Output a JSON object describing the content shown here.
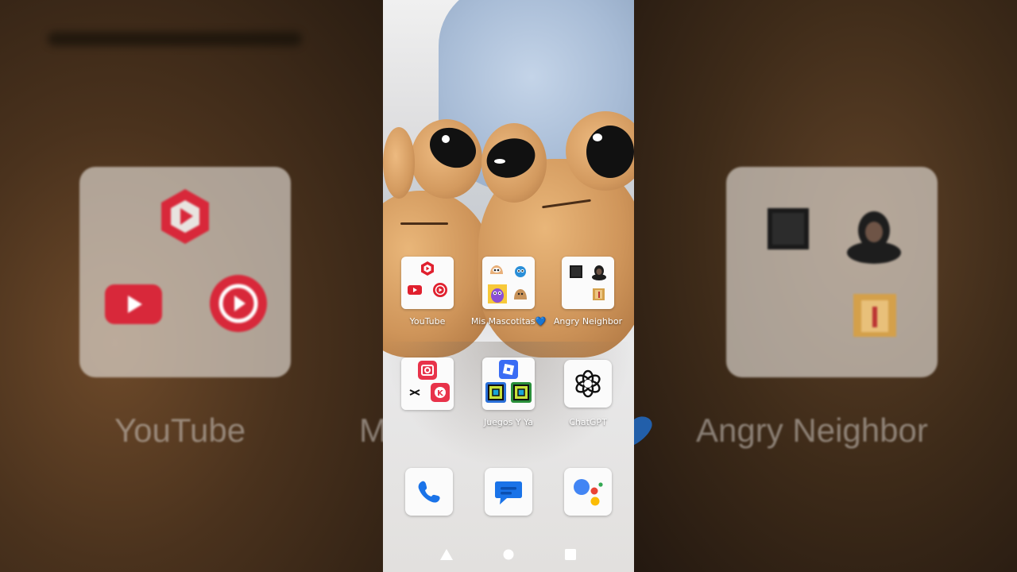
{
  "background": {
    "left_folder_label": "YouTube",
    "mid_partial_label": "M",
    "right_folder_label": "Angry Neighbor"
  },
  "home": {
    "folders": [
      {
        "label": "YouTube",
        "icons": [
          "youtube-studio-icon",
          "youtube-icon",
          "youtube-music-icon"
        ]
      },
      {
        "label": "Mis Mascotitas💙",
        "icons": [
          "pet-game-icon",
          "pet-blue-icon",
          "purple-monster-icon",
          "pou-icon"
        ]
      },
      {
        "label": "Angry Neighbor",
        "icons": [
          "dark-game-icon",
          "hooded-figure-icon",
          "blank-icon",
          "neighbor-door-icon"
        ]
      },
      {
        "label": "",
        "icons": [
          "inshot-icon",
          "capcut-icon",
          "kinemaster-icon"
        ]
      },
      {
        "label": "Juegos Y Ya",
        "icons": [
          "roblox-icon",
          "geometry-dash-icon",
          "geometry-dash-lite-icon"
        ]
      }
    ],
    "chatgpt_label": "ChatGPT",
    "dock": [
      "phone-icon",
      "messages-icon",
      "assistant-icon"
    ]
  },
  "navbar": [
    "back-icon",
    "home-icon",
    "recents-icon"
  ],
  "colors": {
    "youtube_red": "#e0202e",
    "google_blue": "#4285f4",
    "google_red": "#ea4335",
    "google_yellow": "#fbbc05",
    "google_green": "#34a853"
  }
}
